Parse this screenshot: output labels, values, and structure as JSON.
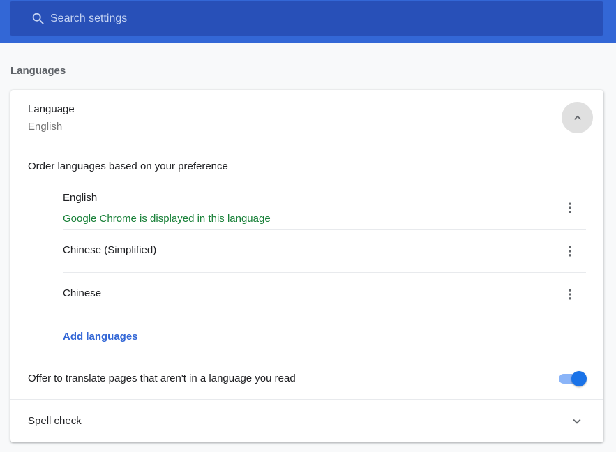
{
  "search": {
    "placeholder": "Search settings"
  },
  "section": {
    "title": "Languages"
  },
  "language_card": {
    "title": "Language",
    "current_value": "English",
    "order_label": "Order languages based on your preference",
    "languages": [
      {
        "name": "English",
        "note": "Google Chrome is displayed in this language"
      },
      {
        "name": "Chinese (Simplified)"
      },
      {
        "name": "Chinese"
      }
    ],
    "add_languages_label": "Add languages",
    "translate_label": "Offer to translate pages that aren't in a language you read",
    "translate_enabled": true
  },
  "spell_check": {
    "label": "Spell check"
  },
  "colors": {
    "header": "#3367d6",
    "search_box": "#2850b8",
    "link": "#3367d6",
    "note_green": "#188038",
    "toggle_on": "#1a73e8"
  },
  "icons": {
    "search": "search-icon",
    "collapse": "chevron-up-icon",
    "more": "more-vert-icon",
    "expand": "chevron-down-icon"
  }
}
